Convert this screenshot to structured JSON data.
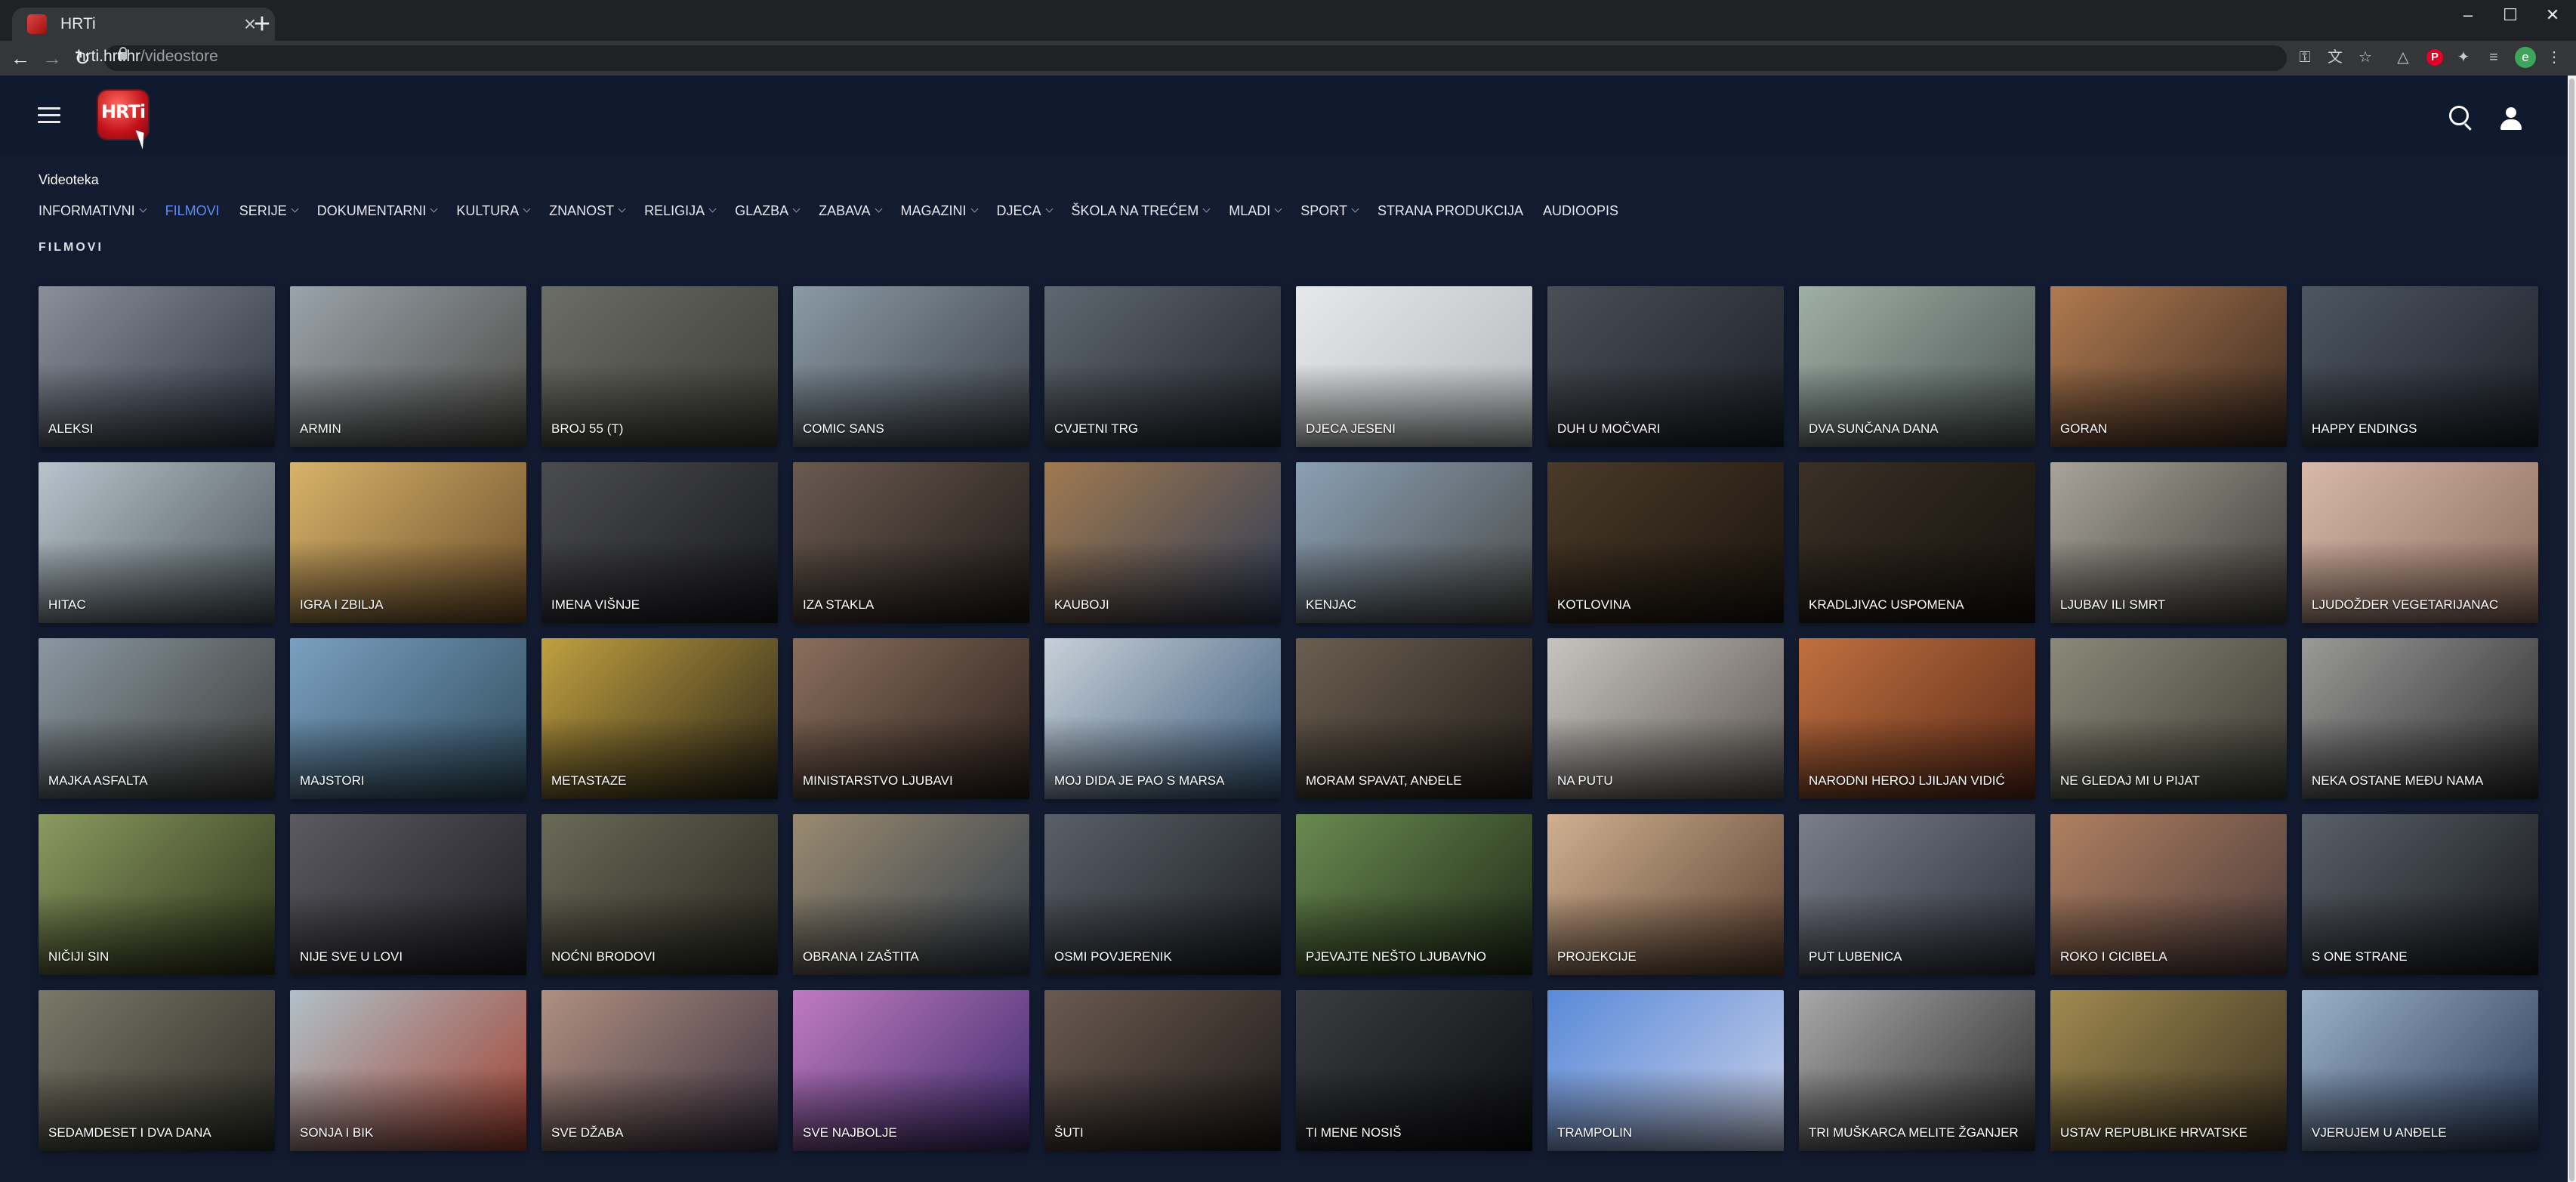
{
  "browser": {
    "tab_title": "HRTi",
    "url_host": "hrti.hrt.hr",
    "url_path": "/videostore"
  },
  "header": {
    "logo_text": "HRTi"
  },
  "section_label": "Videoteka",
  "categories": [
    {
      "label": "INFORMATIVNI",
      "dropdown": true
    },
    {
      "label": "FILMOVI",
      "dropdown": false,
      "active": true
    },
    {
      "label": "SERIJE",
      "dropdown": true
    },
    {
      "label": "DOKUMENTARNI",
      "dropdown": true
    },
    {
      "label": "KULTURA",
      "dropdown": true
    },
    {
      "label": "ZNANOST",
      "dropdown": true
    },
    {
      "label": "RELIGIJA",
      "dropdown": true
    },
    {
      "label": "GLAZBA",
      "dropdown": true
    },
    {
      "label": "ZABAVA",
      "dropdown": true
    },
    {
      "label": "MAGAZINI",
      "dropdown": true
    },
    {
      "label": "DJECA",
      "dropdown": true
    },
    {
      "label": "ŠKOLA NA TREĆEM",
      "dropdown": true
    },
    {
      "label": "MLADI",
      "dropdown": true
    },
    {
      "label": "SPORT",
      "dropdown": true
    },
    {
      "label": "STRANA PRODUKCIJA",
      "dropdown": false
    },
    {
      "label": "AUDIOOPIS",
      "dropdown": false
    }
  ],
  "page_title": "FILMOVI",
  "colors": {
    "background": "#131b30",
    "active_category": "#5b8df0"
  },
  "movies": [
    {
      "title": "ALEKSI",
      "c1": "#8a8f99",
      "c2": "#2c3340"
    },
    {
      "title": "ARMIN",
      "c1": "#9aa3ab",
      "c2": "#4b4a45"
    },
    {
      "title": "BROJ 55 (T)",
      "c1": "#6b6e66",
      "c2": "#3a3b33"
    },
    {
      "title": "COMIC SANS",
      "c1": "#8a9aa5",
      "c2": "#3c4048"
    },
    {
      "title": "CVJETNI TRG",
      "c1": "#5f6770",
      "c2": "#22262d"
    },
    {
      "title": "DJECA JESENI",
      "c1": "#e6e8e9",
      "c2": "#b4b8ba"
    },
    {
      "title": "DUH U MOČVARI",
      "c1": "#4a4f57",
      "c2": "#1c1f26"
    },
    {
      "title": "DVA SUNČANA DANA",
      "c1": "#9fb0a8",
      "c2": "#4a5350"
    },
    {
      "title": "GORAN",
      "c1": "#b07a50",
      "c2": "#3b2a20"
    },
    {
      "title": "HAPPY ENDINGS",
      "c1": "#4e5661",
      "c2": "#1c2028"
    },
    {
      "title": "HITAC",
      "c1": "#b8c4cc",
      "c2": "#4a5358"
    },
    {
      "title": "IGRA I ZBILJA",
      "c1": "#d8b36a",
      "c2": "#6a4d2a"
    },
    {
      "title": "IMENA VIŠNJE",
      "c1": "#4b4c50",
      "c2": "#18191d"
    },
    {
      "title": "IZA STAKLA",
      "c1": "#6a5a50",
      "c2": "#1f1a18"
    },
    {
      "title": "KAUBOJI",
      "c1": "#a07a50",
      "c2": "#2f3b55"
    },
    {
      "title": "KENJAC",
      "c1": "#8aa0b5",
      "c2": "#4a4a48"
    },
    {
      "title": "KOTLOVINA",
      "c1": "#4a3a28",
      "c2": "#1a140e"
    },
    {
      "title": "KRADLJIVAC USPOMENA",
      "c1": "#3a3026",
      "c2": "#15110d"
    },
    {
      "title": "LJUBAV ILI SMRT",
      "c1": "#a8a49a",
      "c2": "#3d3b36"
    },
    {
      "title": "LJUDOŽDER VEGETARIJANAC",
      "c1": "#d8b8a8",
      "c2": "#8a6a5c"
    },
    {
      "title": "MAJKA ASFALTA",
      "c1": "#8a98a2",
      "c2": "#3a3a36"
    },
    {
      "title": "MAJSTORI",
      "c1": "#7aa0c0",
      "c2": "#2e4a5c"
    },
    {
      "title": "METASTAZE",
      "c1": "#c0a040",
      "c2": "#2a2418"
    },
    {
      "title": "MINISTARSTVO LJUBAVI",
      "c1": "#8a6e5c",
      "c2": "#2a201c"
    },
    {
      "title": "MOJ DIDA JE PAO S MARSA",
      "c1": "#c8d0d8",
      "c2": "#3a5a7a"
    },
    {
      "title": "MORAM SPAVAT, ANĐELE",
      "c1": "#6a5e50",
      "c2": "#231e19"
    },
    {
      "title": "NA PUTU",
      "c1": "#c8c4c0",
      "c2": "#5a5550"
    },
    {
      "title": "NARODNI HEROJ LJILJAN VIDIĆ",
      "c1": "#c07040",
      "c2": "#5a2a18"
    },
    {
      "title": "NE GLEDAJ MI U PIJAT",
      "c1": "#8a8a7a",
      "c2": "#3a3a32"
    },
    {
      "title": "NEKA OSTANE MEĐU NAMA",
      "c1": "#9a9a98",
      "c2": "#2a2a2c"
    },
    {
      "title": "NIČIJI SIN",
      "c1": "#8a9a60",
      "c2": "#2a3018"
    },
    {
      "title": "NIJE SVE U LOVI",
      "c1": "#5a5a60",
      "c2": "#1c1c22"
    },
    {
      "title": "NOĆNI BRODOVI",
      "c1": "#6a6a58",
      "c2": "#25251e"
    },
    {
      "title": "OBRANA I ZAŠTITA",
      "c1": "#9a8a70",
      "c2": "#2e3a48"
    },
    {
      "title": "OSMI POVJERENIK",
      "c1": "#5a6068",
      "c2": "#1a1d22"
    },
    {
      "title": "PJEVAJTE NEŠTO LJUBAVNO",
      "c1": "#6a8a50",
      "c2": "#1e2a18"
    },
    {
      "title": "PROJEKCIJE",
      "c1": "#d0b090",
      "c2": "#5a4030"
    },
    {
      "title": "PUT LUBENICA",
      "c1": "#7a7e88",
      "c2": "#2a2e38"
    },
    {
      "title": "ROKO I CICIBELA",
      "c1": "#b08060",
      "c2": "#4a3a3a"
    },
    {
      "title": "S ONE STRANE",
      "c1": "#5a6068",
      "c2": "#15181d"
    },
    {
      "title": "SEDAMDESET I DVA DANA",
      "c1": "#7a7868",
      "c2": "#2a2a24"
    },
    {
      "title": "SONJA I BIK",
      "c1": "#b0c0c8",
      "c2": "#a04030"
    },
    {
      "title": "SVE DŽABA",
      "c1": "#b09080",
      "c2": "#3a3040"
    },
    {
      "title": "SVE NAJBOLJE",
      "c1": "#c07ac0",
      "c2": "#3a2a6a"
    },
    {
      "title": "ŠUTI",
      "c1": "#6a5a50",
      "c2": "#1e1a18"
    },
    {
      "title": "TI MENE NOSIŠ",
      "c1": "#3a3c40",
      "c2": "#0c0d10"
    },
    {
      "title": "TRAMPOLIN",
      "c1": "#5a8ad8",
      "c2": "#c8d0e8"
    },
    {
      "title": "TRI MUŠKARCA MELITE ŽGANJER",
      "c1": "#a8a8a8",
      "c2": "#2a2a2a"
    },
    {
      "title": "USTAV REPUBLIKE HRVATSKE",
      "c1": "#a08a50",
      "c2": "#3a3020"
    },
    {
      "title": "VJERUJEM U ANĐELE",
      "c1": "#9ab0c8",
      "c2": "#2a3a58"
    }
  ]
}
